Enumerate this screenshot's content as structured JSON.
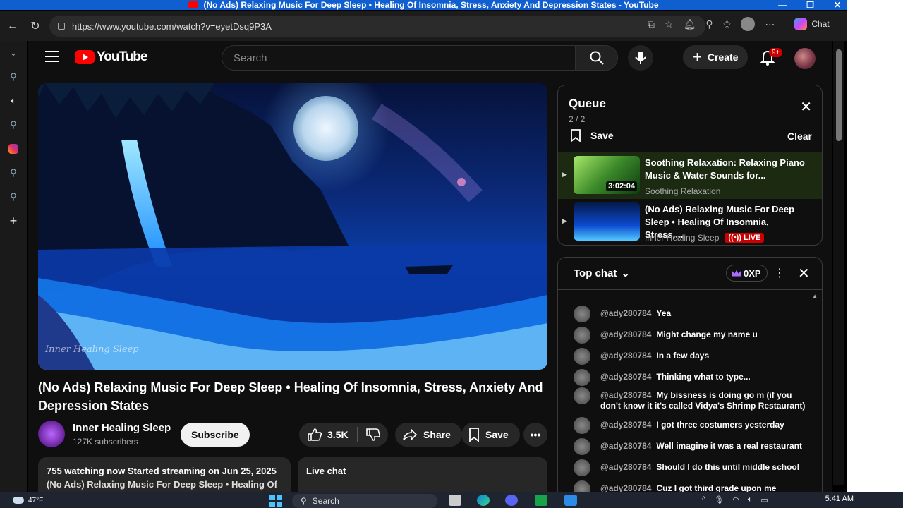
{
  "window": {
    "title": "(No Ads) Relaxing Music For Deep Sleep • Healing Of Insomnia, Stress, Anxiety And Depression States - YouTube"
  },
  "browser": {
    "url": "https://www.youtube.com/watch?v=eyetDsq9P3A",
    "chat_label": "Chat"
  },
  "yt": {
    "logo_text": "YouTube",
    "search_placeholder": "Search",
    "create_label": "Create",
    "notif_badge": "9+"
  },
  "video": {
    "title": "(No Ads) Relaxing Music For Deep Sleep • Healing Of Insomnia, Stress, Anxiety And Depression States",
    "watermark": "Inner Healing Sleep",
    "channel": "Inner Healing Sleep",
    "subscribers": "127K subscribers",
    "subscribe_label": "Subscribe",
    "likes": "3.5K",
    "share_label": "Share",
    "save_label": "Save",
    "desc_line1": "755 watching now  Started streaming on Jun 25, 2025",
    "desc_line2": "(No Ads) Relaxing Music For Deep Sleep • Healing Of",
    "live_chat_label": "Live chat"
  },
  "queue": {
    "title": "Queue",
    "count": "2 / 2",
    "save_label": "Save",
    "clear_label": "Clear",
    "items": [
      {
        "title": "Soothing Relaxation: Relaxing Piano Music & Water Sounds for...",
        "channel": "Soothing Relaxation",
        "duration": "3:02:04"
      },
      {
        "title": "(No Ads) Relaxing Music For Deep Sleep • Healing Of Insomnia, Stress,...",
        "channel": "Inner Healing Sleep",
        "live": "LIVE"
      }
    ]
  },
  "chat": {
    "header": "Top chat",
    "xp": "0XP",
    "messages": [
      {
        "author": "@ady280784",
        "text": "Yea"
      },
      {
        "author": "@ady280784",
        "text": "Might change my name u"
      },
      {
        "author": "@ady280784",
        "text": "In a few days"
      },
      {
        "author": "@ady280784",
        "text": "Thinking what to type..."
      },
      {
        "author": "@ady280784",
        "text": "My bissness is doing go m (if you don't know it it's called Vidya's Shrimp Restaurant)"
      },
      {
        "author": "@ady280784",
        "text": "I got three costumers yesterday"
      },
      {
        "author": "@ady280784",
        "text": "Well imagine it was a real restaurant"
      },
      {
        "author": "@ady280784",
        "text": "Should I do this until middle school"
      },
      {
        "author": "@ady280784",
        "text": "Cuz I got third grade upon me"
      }
    ]
  },
  "taskbar": {
    "temp": "47°F",
    "search": "Search",
    "time": "5:41 AM"
  }
}
